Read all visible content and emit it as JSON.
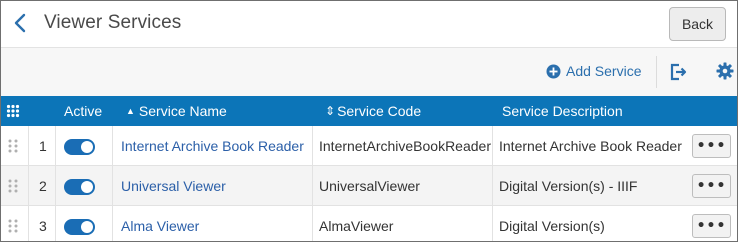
{
  "header": {
    "title": "Viewer Services",
    "back_label": "Back"
  },
  "toolbar": {
    "add_service_label": "Add Service"
  },
  "table": {
    "columns": {
      "active": "Active",
      "service_name": "Service Name",
      "service_code": "Service Code",
      "service_description": "Service Description"
    },
    "sort_indicators": {
      "service_name": "▲",
      "service_code": "⇕"
    },
    "rows": [
      {
        "index": "1",
        "active": true,
        "name": "Internet Archive Book Reader",
        "code": "InternetArchiveBookReader",
        "description": "Internet Archive Book Reader",
        "actions": "•••"
      },
      {
        "index": "2",
        "active": true,
        "name": "Universal Viewer",
        "code": "UniversalViewer",
        "description": "Digital Version(s) - IIIF",
        "actions": "•••"
      },
      {
        "index": "3",
        "active": true,
        "name": "Alma Viewer",
        "code": "AlmaViewer",
        "description": "Digital Version(s)",
        "actions": "•••"
      }
    ]
  },
  "colors": {
    "accent": "#0c75b8",
    "link": "#2b5fa8",
    "toggle_on": "#1a6db5"
  }
}
